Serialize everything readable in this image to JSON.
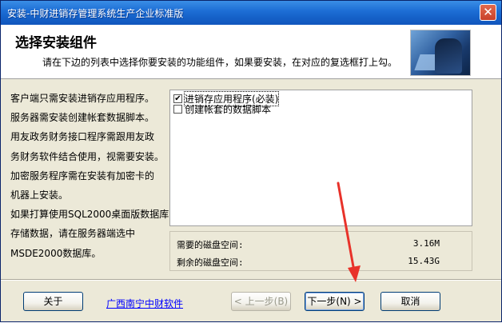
{
  "window": {
    "title": "安装-中财进销存管理系统生产企业标准版",
    "close_symbol": "✕"
  },
  "header": {
    "title": "选择安装组件",
    "subtitle": "请在下边的列表中选择你要安装的功能组件，如果要安装，在对应的复选框打上勾。"
  },
  "description": [
    "客户端只需安装进销存应用程序。",
    "服务器需安装创建帐套数据脚本。",
    "用友政务财务接口程序需跟用友政",
    "务财务软件结合使用，视需要安装。",
    "加密服务程序需在安装有加密卡的",
    "机器上安装。",
    "如果打算使用SQL2000桌面版数据库",
    "存储数据，请在服务器端选中",
    "MSDE2000数据库。"
  ],
  "components": [
    {
      "label": "进销存应用程序(必装)",
      "checked": true
    },
    {
      "label": "创建帐套的数据脚本",
      "checked": false
    }
  ],
  "disk": {
    "required_label": "需要的磁盘空间:",
    "required_value": "3.16M",
    "remaining_label": "剩余的磁盘空间:",
    "remaining_value": "15.43G"
  },
  "footer": {
    "about_label": "关于",
    "link_text": "广西南宁中财软件",
    "back_label": "< 上一步(B)",
    "next_label": "下一步(N) >",
    "cancel_label": "取消"
  },
  "colors": {
    "titlebar": "#1e6fd6",
    "annotation_arrow": "#e8322a",
    "link": "#0000ff"
  }
}
